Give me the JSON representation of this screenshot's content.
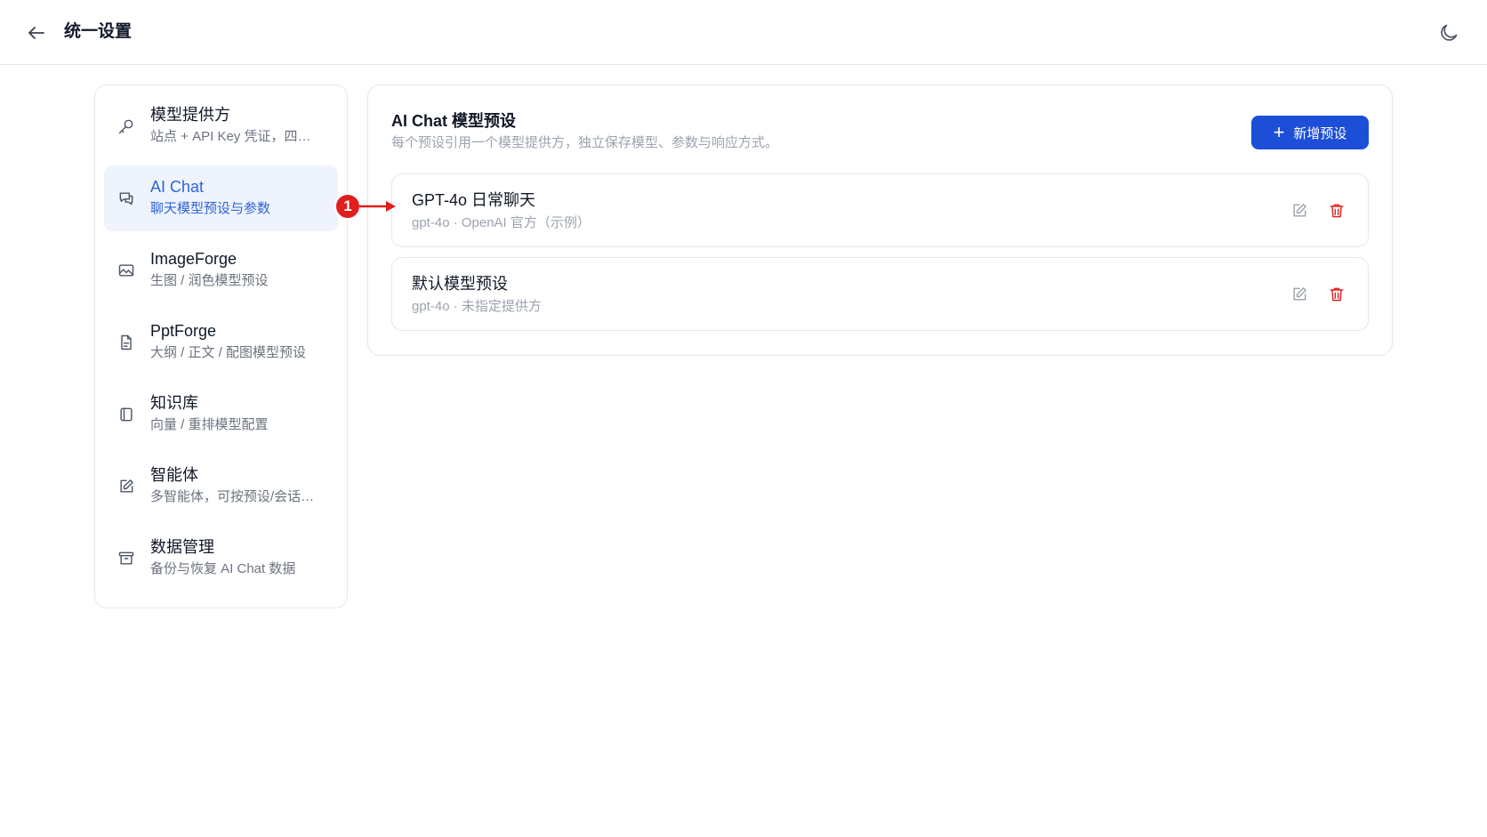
{
  "header": {
    "title": "统一设置"
  },
  "sidebar": {
    "items": [
      {
        "title": "模型提供方",
        "subtitle": "站点 + API Key 凭证，四…",
        "icon": "key-icon"
      },
      {
        "title": "AI Chat",
        "subtitle": "聊天模型预设与参数",
        "icon": "chat-icon"
      },
      {
        "title": "ImageForge",
        "subtitle": "生图 / 润色模型预设",
        "icon": "image-icon"
      },
      {
        "title": "PptForge",
        "subtitle": "大纲 / 正文 / 配图模型预设",
        "icon": "file-icon"
      },
      {
        "title": "知识库",
        "subtitle": "向量 / 重排模型配置",
        "icon": "book-icon"
      },
      {
        "title": "智能体",
        "subtitle": "多智能体，可按预设/会话…",
        "icon": "edit-icon"
      },
      {
        "title": "数据管理",
        "subtitle": "备份与恢复 AI Chat 数据",
        "icon": "archive-icon"
      }
    ]
  },
  "main": {
    "title": "AI Chat 模型预设",
    "subtitle": "每个预设引用一个模型提供方，独立保存模型、参数与响应方式。",
    "add_button": {
      "icon": "+",
      "label": "新增预设"
    },
    "presets": [
      {
        "name": "GPT-4o 日常聊天",
        "meta": "gpt-4o · OpenAI 官方（示例）"
      },
      {
        "name": "默认模型预设",
        "meta": "gpt-4o · 未指定提供方"
      }
    ]
  },
  "annotation": {
    "number": "1"
  },
  "colors": {
    "accent": "#1d4ed8",
    "active_text": "#2f64d8",
    "active_bg": "#eef3fd",
    "danger": "#dc2626",
    "annotation": "#e11d1d"
  }
}
